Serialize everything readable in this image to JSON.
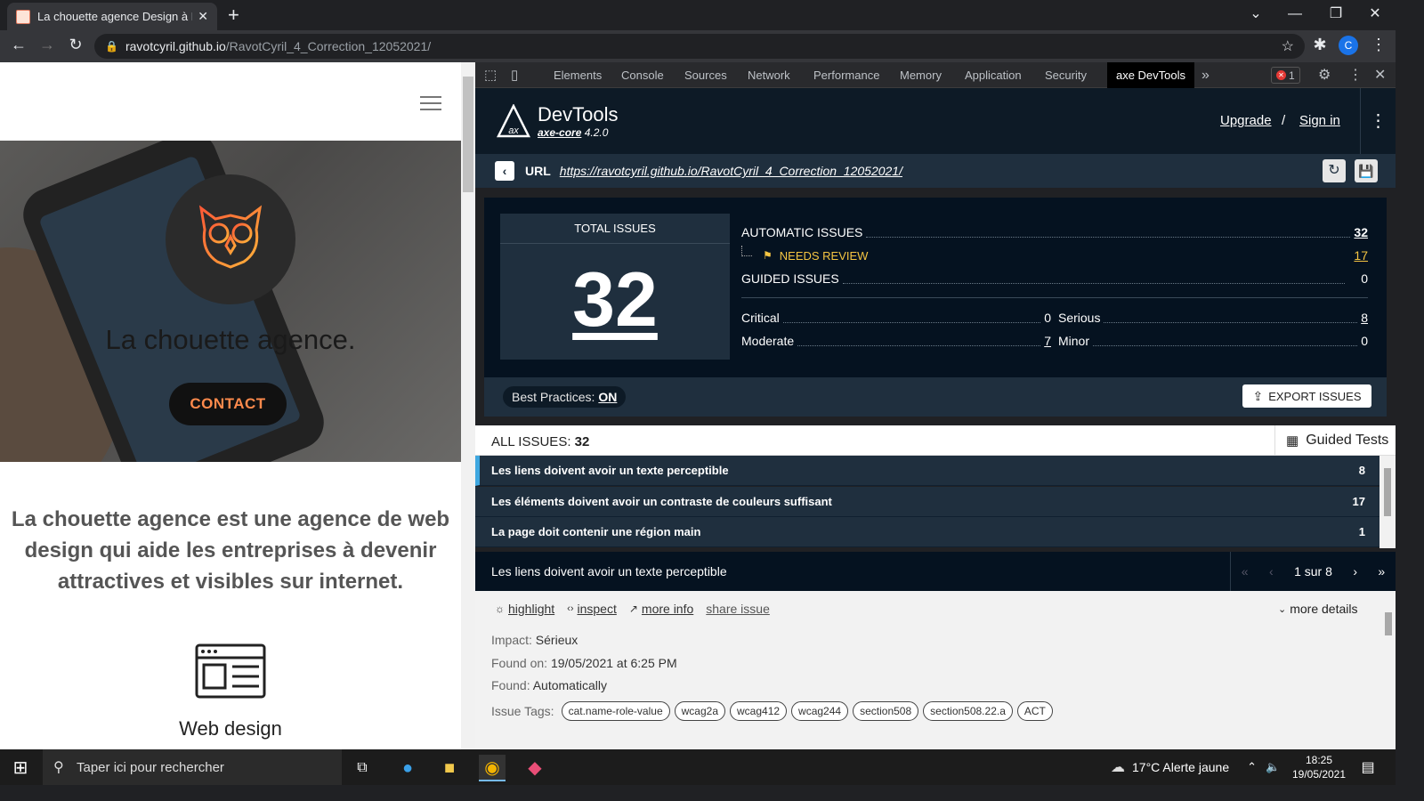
{
  "browser": {
    "tab_title": "La chouette agence Design à Lyon",
    "tab_close": "✕",
    "new_tab": "+",
    "url_host": "ravotcyril.github.io",
    "url_path": "/RavotCyril_4_Correction_12052021/",
    "profile_initial": "C"
  },
  "page": {
    "hero_title": "La chouette agence.",
    "contact_button": "CONTACT",
    "lead_text": "La chouette agence est une agence de web design qui aide les entreprises à devenir attractives et visibles sur internet.",
    "service_title": "Web design"
  },
  "devtools": {
    "tabs": [
      "Elements",
      "Console",
      "Sources",
      "Network",
      "Performance",
      "Memory",
      "Application",
      "Security"
    ],
    "active_tab": "axe DevTools",
    "more_tabs": "»",
    "error_count": "1"
  },
  "axe": {
    "title": "DevTools",
    "core_label": "axe-core",
    "core_version": "4.2.0",
    "upgrade": "Upgrade",
    "separator": "/",
    "sign_in": "Sign in",
    "url_label": "URL",
    "url": "https://ravotcyril.github.io/RavotCyril_4_Correction_12052021/",
    "total_label": "TOTAL ISSUES",
    "total": "32",
    "automatic_label": "AUTOMATIC ISSUES",
    "automatic": "32",
    "needs_review_label": "NEEDS REVIEW",
    "needs_review": "17",
    "guided_label": "GUIDED ISSUES",
    "guided": "0",
    "critical_label": "Critical",
    "critical": "0",
    "serious_label": "Serious",
    "serious": "8",
    "moderate_label": "Moderate",
    "moderate": "7",
    "minor_label": "Minor",
    "minor": "0",
    "best_practices_label": "Best Practices:",
    "best_practices_value": "ON",
    "export_label": "EXPORT ISSUES",
    "all_issues_label": "ALL ISSUES:",
    "all_issues_count": "32",
    "guided_tests": "Guided Tests",
    "issues": [
      {
        "title": "Les liens doivent avoir un texte perceptible",
        "count": "8"
      },
      {
        "title": "Les éléments doivent avoir un contraste de couleurs suffisant",
        "count": "17"
      },
      {
        "title": "La page doit contenir une région main",
        "count": "1"
      }
    ],
    "detail_title": "Les liens doivent avoir un texte perceptible",
    "pager": "1 sur 8",
    "actions": {
      "highlight": "highlight",
      "inspect": "inspect",
      "more_info": "more info",
      "share": "share issue",
      "more_details": "more details"
    },
    "impact_label": "Impact:",
    "impact": "Sérieux",
    "found_on_label": "Found on:",
    "found_on": "19/05/2021 at 6:25 PM",
    "found_label": "Found:",
    "found": "Automatically",
    "tags_label": "Issue Tags:",
    "tags": [
      "cat.name-role-value",
      "wcag2a",
      "wcag412",
      "wcag244",
      "section508",
      "section508.22.a",
      "ACT"
    ]
  },
  "taskbar": {
    "search_placeholder": "Taper ici pour rechercher",
    "weather": "17°C  Alerte jaune",
    "time": "18:25",
    "date": "19/05/2021"
  },
  "colors": {
    "axe_dark": "#0d1a26",
    "axe_panel": "#1f2f3e",
    "accent_blue": "#3ea7e0",
    "needs_review": "#f5c542",
    "contact_text": "#ff8a4c"
  }
}
